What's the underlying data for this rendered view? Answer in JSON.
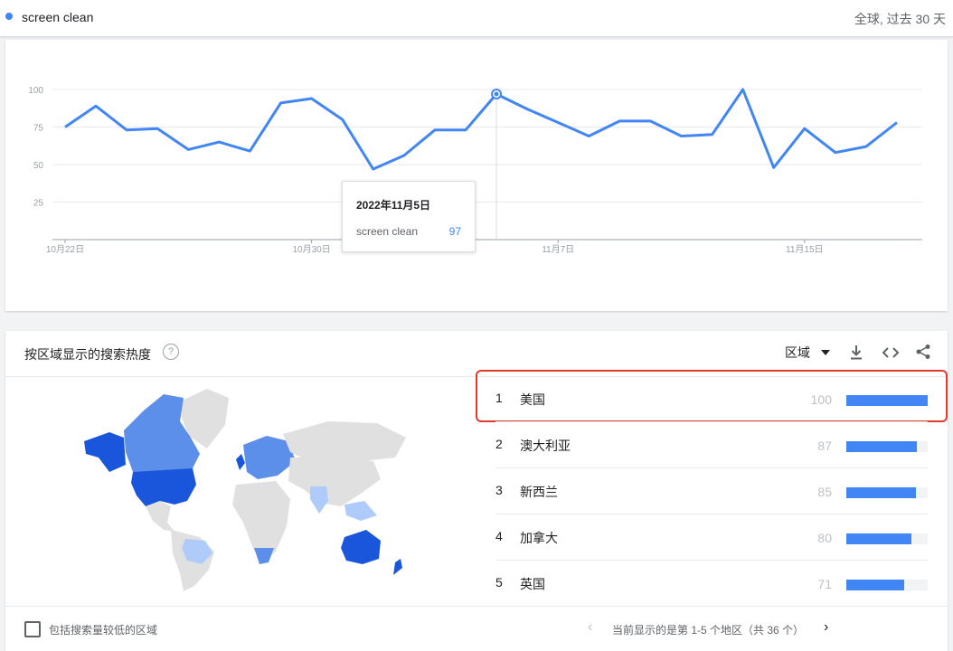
{
  "header": {
    "term": "screen clean",
    "scope": "全球, 过去 30 天",
    "series_color": "#4285f4"
  },
  "chart_data": {
    "type": "line",
    "y_ticks": [
      "100",
      "75",
      "50",
      "25"
    ],
    "ylim": [
      0,
      100
    ],
    "x_ticks": [
      "10月22日",
      "10月30日",
      "11月7日",
      "11月15日"
    ],
    "x_tick_index": [
      0,
      8,
      16,
      24
    ],
    "series": [
      {
        "name": "screen clean",
        "values": [
          75,
          89,
          73,
          74,
          60,
          65,
          59,
          91,
          94,
          80,
          47,
          56,
          73,
          73,
          97,
          87,
          78,
          69,
          79,
          79,
          69,
          70,
          100,
          48,
          74,
          58,
          62,
          78
        ]
      }
    ],
    "highlight_index": 14,
    "grid": true
  },
  "tooltip": {
    "date": "2022年11月5日",
    "term": "screen clean",
    "value": "97"
  },
  "region": {
    "title": "按区域显示的搜索热度",
    "help_icon": "?",
    "view_label": "区域",
    "items": [
      {
        "rank": "1",
        "name": "美国",
        "value": "100",
        "fraction": 1.0
      },
      {
        "rank": "2",
        "name": "澳大利亚",
        "value": "87",
        "fraction": 0.87
      },
      {
        "rank": "3",
        "name": "新西兰",
        "value": "85",
        "fraction": 0.85
      },
      {
        "rank": "4",
        "name": "加拿大",
        "value": "80",
        "fraction": 0.8
      },
      {
        "rank": "5",
        "name": "英国",
        "value": "71",
        "fraction": 0.71
      }
    ],
    "checkbox_label": "包括搜索量较低的区域",
    "pager_text": "当前显示的是第 1-5 个地区（共 36 个）",
    "icons": {
      "dropdown": "caret-down-icon",
      "download": "download-icon",
      "embed": "embed-icon",
      "share": "share-icon",
      "prev": "chevron-left-icon",
      "next": "chevron-right-icon"
    },
    "colors": {
      "highlight_border": "#e03a2c",
      "bar": "#4285f4",
      "map_high": "#1a56db",
      "map_mid": "#5c8fea",
      "map_low": "#aecbfa",
      "map_none": "#e0e0e0"
    }
  }
}
